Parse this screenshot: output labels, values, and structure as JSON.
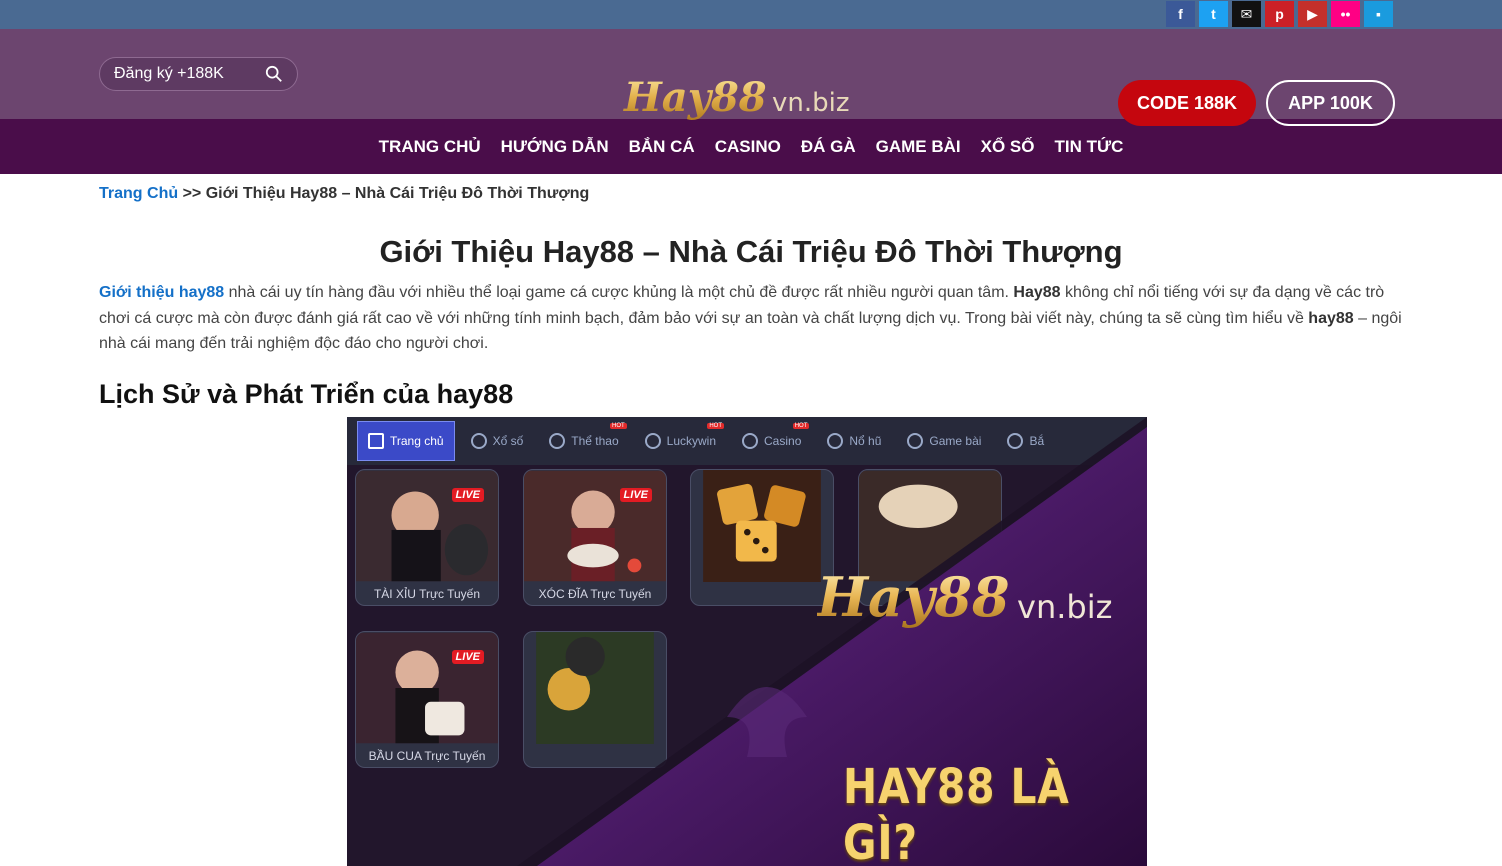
{
  "topbar": {
    "social": [
      {
        "icon": "facebook-icon",
        "glyph": "f",
        "color": "#3b5998"
      },
      {
        "icon": "twitter-icon",
        "glyph": "t",
        "color": "#1da1f2"
      },
      {
        "icon": "email-icon",
        "glyph": "✉",
        "color": "#111111"
      },
      {
        "icon": "pinterest-icon",
        "glyph": "p",
        "color": "#cb2027"
      },
      {
        "icon": "youtube-icon",
        "glyph": "▶",
        "color": "#c4302b"
      },
      {
        "icon": "flickr-icon",
        "glyph": "••",
        "color": "#ff0084"
      },
      {
        "icon": "chat-icon",
        "glyph": "▪",
        "color": "#1a9bde"
      }
    ]
  },
  "header": {
    "search_placeholder": "Đăng ký +188K",
    "logo_text": "Hay88",
    "logo_domain": "vn.biz",
    "code_button": "CODE 188K",
    "app_button": "APP 100K"
  },
  "nav": {
    "items": [
      "TRANG CHỦ",
      "HƯỚNG DẪN",
      "BẮN CÁ",
      "CASINO",
      "ĐÁ GÀ",
      "GAME BÀI",
      "XỔ SỐ",
      "TIN TỨC"
    ]
  },
  "breadcrumb": {
    "home": "Trang Chủ",
    "separator": ">>",
    "current": "Giới Thiệu Hay88 – Nhà Cái Triệu Đô Thời Thượng"
  },
  "article": {
    "title": "Giới Thiệu Hay88 – Nhà Cái Triệu Đô Thời Thượng",
    "intro_link": "Giới thiệu hay88",
    "intro_1": " nhà cái uy tín hàng đầu với nhiều thể loại game cá cược khủng là một chủ đề được rất nhiều người quan tâm. ",
    "intro_bold_1": "Hay88",
    "intro_2": " không chỉ nổi tiếng với sự đa dạng về các trò chơi cá cược mà còn được đánh giá rất cao về với những tính minh bạch, đảm bảo với sự an toàn và chất lượng dịch vụ. Trong bài viết này, chúng ta sẽ cùng tìm hiểu về ",
    "intro_bold_2": "hay88",
    "intro_3": " – ngôi nhà cái mang đến trải nghiệm độc đáo cho người chơi.",
    "section_heading": "Lịch Sử và Phát Triển của hay88"
  },
  "hero": {
    "tabs": [
      {
        "label": "Trang chủ",
        "icon": "home-icon",
        "active": true,
        "hot": false
      },
      {
        "label": "Xổ số",
        "icon": "lottery-icon",
        "active": false,
        "hot": false
      },
      {
        "label": "Thể thao",
        "icon": "sports-icon",
        "active": false,
        "hot": true
      },
      {
        "label": "Luckywin",
        "icon": "luckywin-icon",
        "active": false,
        "hot": true
      },
      {
        "label": "Casino",
        "icon": "casino-icon",
        "active": false,
        "hot": true
      },
      {
        "label": "Nổ hũ",
        "icon": "slots-icon",
        "active": false,
        "hot": false
      },
      {
        "label": "Game bài",
        "icon": "cards-icon",
        "active": false,
        "hot": false
      },
      {
        "label": "Bắ",
        "icon": "fish-icon",
        "active": false,
        "hot": false
      }
    ],
    "hot_label": "HOT",
    "live_label": "LIVE",
    "cards": [
      "TÀI XỈU Trực Tuyến",
      "XÓC ĐĨA Trực Tuyến",
      "BẦU CUA Trực Tuyến"
    ],
    "logo_text": "Hay88",
    "logo_domain": "vn.biz",
    "headline": "HAY88 LÀ GÌ?"
  }
}
